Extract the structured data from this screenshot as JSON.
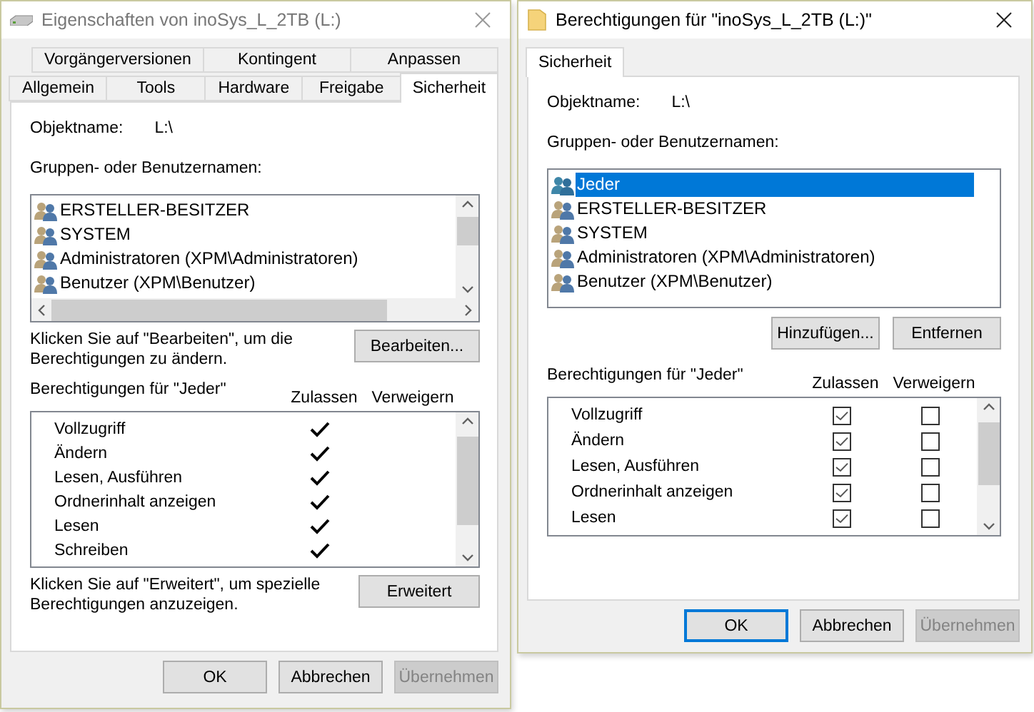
{
  "windows": [
    {
      "kind": "drive",
      "title": "Eigenschaften von inoSys_L_2TB (L:)",
      "tab_rows": [
        [
          {
            "label": "Vorgängerversionen",
            "selected": false
          },
          {
            "label": "Kontingent",
            "selected": false
          },
          {
            "label": "Anpassen",
            "selected": false
          }
        ],
        [
          {
            "label": "Allgemein",
            "selected": false
          },
          {
            "label": "Tools",
            "selected": false
          },
          {
            "label": "Hardware",
            "selected": false
          },
          {
            "label": "Freigabe",
            "selected": false
          },
          {
            "label": "Sicherheit",
            "selected": true
          }
        ]
      ],
      "object_label": "Objektname:",
      "object_value": "L:\\",
      "groups_label": "Gruppen- oder Benutzernamen:",
      "users": [
        {
          "kind": "group",
          "name": "ERSTELLER-BESITZER",
          "selected": false
        },
        {
          "kind": "group",
          "name": "SYSTEM",
          "selected": false
        },
        {
          "kind": "group",
          "name": "Administratoren (XPM\\Administratoren)",
          "selected": false
        },
        {
          "kind": "group",
          "name": "Benutzer (XPM\\Benutzer)",
          "selected": false
        }
      ],
      "edit_hint": "Klicken Sie auf \"Bearbeiten\", um die Berechtigungen zu ändern.",
      "list_buttons": [
        "Bearbeiten..."
      ],
      "permissions_label": "Berechtigungen für \"Jeder\"",
      "allow_header": "Zulassen",
      "deny_header": "Verweigern",
      "permissions": [
        {
          "name": "Vollzugriff",
          "allow": true,
          "deny": false
        },
        {
          "name": "Ändern",
          "allow": true,
          "deny": false
        },
        {
          "name": "Lesen, Ausführen",
          "allow": true,
          "deny": false
        },
        {
          "name": "Ordnerinhalt anzeigen",
          "allow": true,
          "deny": false
        },
        {
          "name": "Lesen",
          "allow": true,
          "deny": false
        },
        {
          "name": "Schreiben",
          "allow": true,
          "deny": false
        }
      ],
      "advanced_hint": "Klicken Sie auf \"Erweitert\", um spezielle Berechtigungen anzuzeigen.",
      "advanced_button": "Erweitert",
      "buttons": [
        {
          "label": "OK",
          "disabled": false,
          "focused": false
        },
        {
          "label": "Abbrechen",
          "disabled": false,
          "focused": false
        },
        {
          "label": "Übernehmen",
          "disabled": true,
          "focused": false
        }
      ]
    },
    {
      "kind": "folder",
      "title": "Berechtigungen für \"inoSys_L_2TB (L:)\"",
      "tab_rows": [
        [
          {
            "label": "Sicherheit",
            "selected": true
          }
        ]
      ],
      "object_label": "Objektname:",
      "object_value": "L:\\",
      "groups_label": "Gruppen- oder Benutzernamen:",
      "users": [
        {
          "kind": "everyone",
          "name": "Jeder",
          "selected": true
        },
        {
          "kind": "group",
          "name": "ERSTELLER-BESITZER",
          "selected": false
        },
        {
          "kind": "group",
          "name": "SYSTEM",
          "selected": false
        },
        {
          "kind": "group",
          "name": "Administratoren (XPM\\Administratoren)",
          "selected": false
        },
        {
          "kind": "group",
          "name": "Benutzer (XPM\\Benutzer)",
          "selected": false
        }
      ],
      "list_buttons": [
        "Hinzufügen...",
        "Entfernen"
      ],
      "permissions_label": "Berechtigungen für \"Jeder\"",
      "allow_header": "Zulassen",
      "deny_header": "Verweigern",
      "permissions": [
        {
          "name": "Vollzugriff",
          "allow": true,
          "deny": false
        },
        {
          "name": "Ändern",
          "allow": true,
          "deny": false
        },
        {
          "name": "Lesen, Ausführen",
          "allow": true,
          "deny": false
        },
        {
          "name": "Ordnerinhalt anzeigen",
          "allow": true,
          "deny": false
        },
        {
          "name": "Lesen",
          "allow": true,
          "deny": false
        }
      ],
      "buttons": [
        {
          "label": "OK",
          "disabled": false,
          "focused": true
        },
        {
          "label": "Abbrechen",
          "disabled": false,
          "focused": false
        },
        {
          "label": "Übernehmen",
          "disabled": true,
          "focused": false
        }
      ]
    }
  ]
}
